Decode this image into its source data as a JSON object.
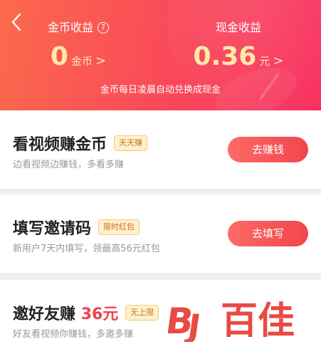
{
  "header": {
    "gold": {
      "title": "金币收益",
      "help": "?",
      "amount": "0",
      "unit": "金币",
      "chevron": ">"
    },
    "cash": {
      "title": "现金收益",
      "amount": "0.36",
      "unit": "元",
      "chevron": ">"
    },
    "note": "金币每日凌晨自动兑换成现金"
  },
  "tasks": [
    {
      "title": "看视频赚金币",
      "tag": "天天赚",
      "desc": "边看视频边赚钱，多看多赚",
      "button": "去赚钱"
    },
    {
      "title": "填写邀请码",
      "tag": "限时红包",
      "desc": "新用户7天内填写，领最高56元红包",
      "button": "去填写"
    },
    {
      "title": "邀好友赚",
      "highlight": "36元",
      "tag": "无上限",
      "desc": "好友看视频你赚钱，多邀多赚"
    }
  ],
  "watermark": {
    "text": "百佳"
  },
  "colors": {
    "accent": "#f0404e",
    "gold": "#ffe9a6",
    "tag_bg": "#fff0cc",
    "tag_text": "#c5731d"
  },
  "icons": {
    "back": "chevron-left-icon",
    "help": "question-circle-icon"
  }
}
